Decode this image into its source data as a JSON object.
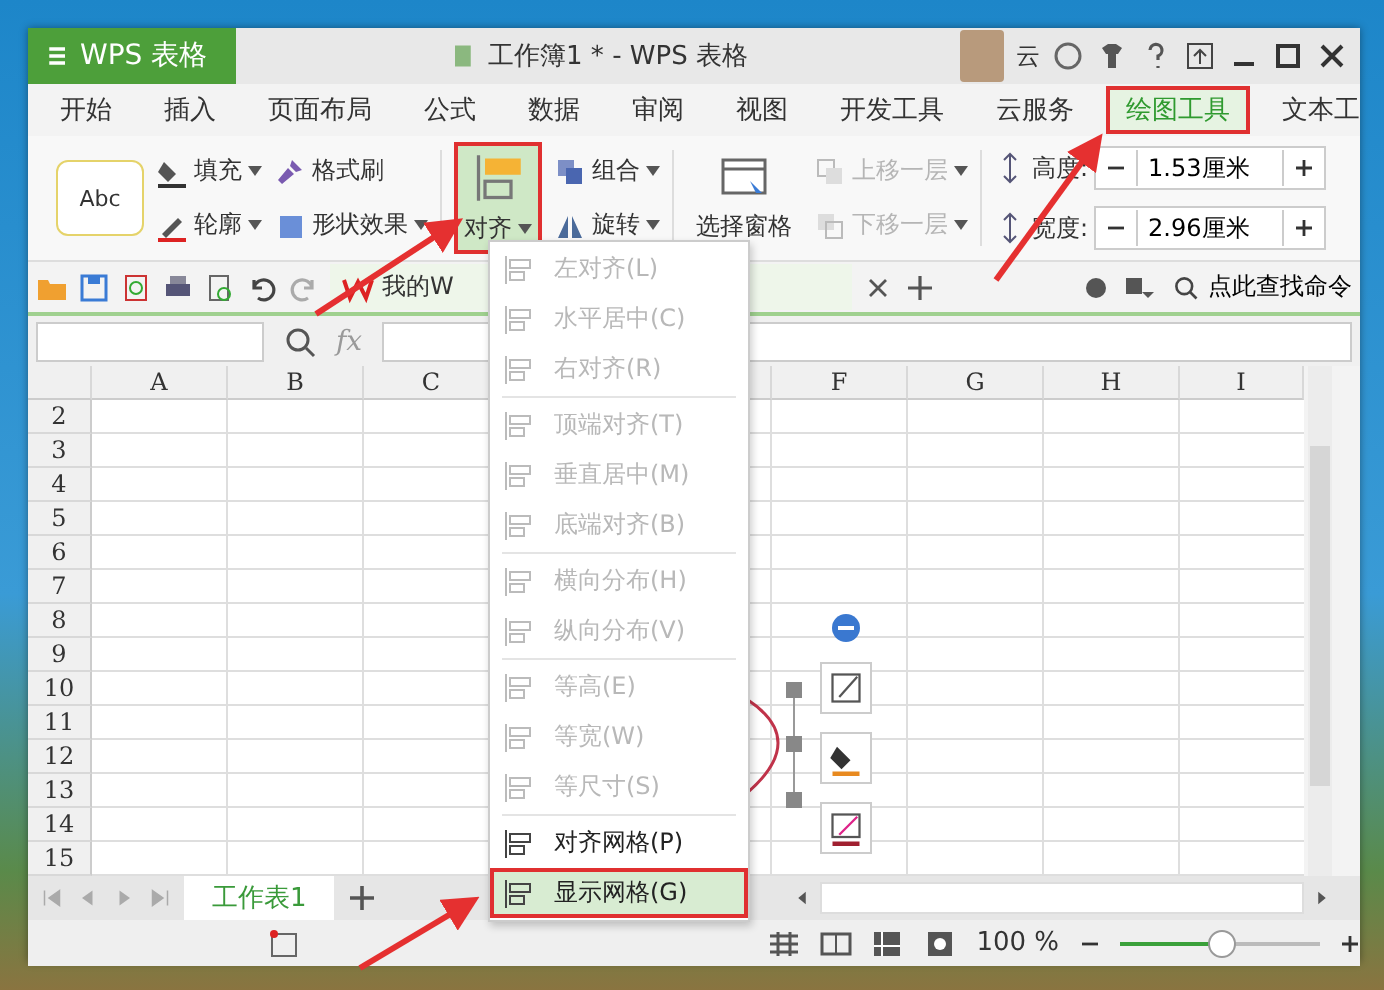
{
  "app_menu": {
    "label": "WPS 表格"
  },
  "window": {
    "title": "工作簿1 * - WPS 表格"
  },
  "account": {
    "name": "云"
  },
  "tabs": [
    {
      "label": "开始",
      "selected": false,
      "annotated": false
    },
    {
      "label": "插入",
      "selected": false,
      "annotated": false
    },
    {
      "label": "页面布局",
      "selected": false,
      "annotated": false
    },
    {
      "label": "公式",
      "selected": false,
      "annotated": false
    },
    {
      "label": "数据",
      "selected": false,
      "annotated": false
    },
    {
      "label": "审阅",
      "selected": false,
      "annotated": false
    },
    {
      "label": "视图",
      "selected": false,
      "annotated": false
    },
    {
      "label": "开发工具",
      "selected": false,
      "annotated": false
    },
    {
      "label": "云服务",
      "selected": false,
      "annotated": false
    },
    {
      "label": "绘图工具",
      "selected": true,
      "annotated": true
    },
    {
      "label": "文本工",
      "selected": false,
      "annotated": false
    }
  ],
  "ribbon": {
    "style_preview": {
      "label": "Abc"
    },
    "fill": {
      "label": "填充"
    },
    "format_painter": {
      "label": "格式刷"
    },
    "outline": {
      "label": "轮廓"
    },
    "shape_effects": {
      "label": "形状效果"
    },
    "align": {
      "label": "对齐",
      "selected": true,
      "annotated": true
    },
    "group": {
      "label": "组合"
    },
    "rotate": {
      "label": "旋转"
    },
    "selection_pane": {
      "label": "选择窗格"
    },
    "bring_forward": {
      "label": "上移一层",
      "disabled": true
    },
    "send_backward": {
      "label": "下移一层",
      "disabled": true
    },
    "size_fields": [
      {
        "label": "高度:",
        "value": "1.53厘米"
      },
      {
        "label": "宽度:",
        "value": "2.96厘米"
      }
    ]
  },
  "document_tab": {
    "label": "我的W"
  },
  "search": {
    "label": "点此查找命令"
  },
  "formula_bar": {
    "function_label": "fx"
  },
  "grid": {
    "columns": [
      {
        "label": "A"
      },
      {
        "label": "B"
      },
      {
        "label": "C"
      },
      {},
      {},
      {
        "label": "F"
      },
      {
        "label": "G"
      },
      {
        "label": "H"
      },
      {
        "label": "I"
      }
    ],
    "rows": [
      "2",
      "3",
      "4",
      "5",
      "6",
      "7",
      "8",
      "9",
      "10",
      "11",
      "12",
      "13",
      "14",
      "15"
    ]
  },
  "align_menu": {
    "items": [
      {
        "kind": "item",
        "label": "左对齐(L)",
        "disabled": true,
        "highlighted": false,
        "annotated": false
      },
      {
        "kind": "item",
        "label": "水平居中(C)",
        "disabled": true,
        "highlighted": false,
        "annotated": false
      },
      {
        "kind": "item",
        "label": "右对齐(R)",
        "disabled": true,
        "highlighted": false,
        "annotated": false
      },
      {
        "kind": "separator"
      },
      {
        "kind": "item",
        "label": "顶端对齐(T)",
        "disabled": true,
        "highlighted": false,
        "annotated": false
      },
      {
        "kind": "item",
        "label": "垂直居中(M)",
        "disabled": true,
        "highlighted": false,
        "annotated": false
      },
      {
        "kind": "item",
        "label": "底端对齐(B)",
        "disabled": true,
        "highlighted": false,
        "annotated": false
      },
      {
        "kind": "separator"
      },
      {
        "kind": "item",
        "label": "横向分布(H)",
        "disabled": true,
        "highlighted": false,
        "annotated": false
      },
      {
        "kind": "item",
        "label": "纵向分布(V)",
        "disabled": true,
        "highlighted": false,
        "annotated": false
      },
      {
        "kind": "separator"
      },
      {
        "kind": "item",
        "label": "等高(E)",
        "disabled": true,
        "highlighted": false,
        "annotated": false
      },
      {
        "kind": "item",
        "label": "等宽(W)",
        "disabled": true,
        "highlighted": false,
        "annotated": false
      },
      {
        "kind": "item",
        "label": "等尺寸(S)",
        "disabled": true,
        "highlighted": false,
        "annotated": false
      },
      {
        "kind": "separator"
      },
      {
        "kind": "item",
        "label": "对齐网格(P)",
        "disabled": false,
        "highlighted": false,
        "annotated": false
      },
      {
        "kind": "item",
        "label": "显示网格(G)",
        "disabled": false,
        "highlighted": true,
        "annotated": true
      }
    ]
  },
  "sheet_tabs": [
    {
      "label": "工作表1",
      "selected": true
    }
  ],
  "status_bar": {
    "zoom_reading": "100 %",
    "zoom": {
      "level": 0.5
    }
  }
}
